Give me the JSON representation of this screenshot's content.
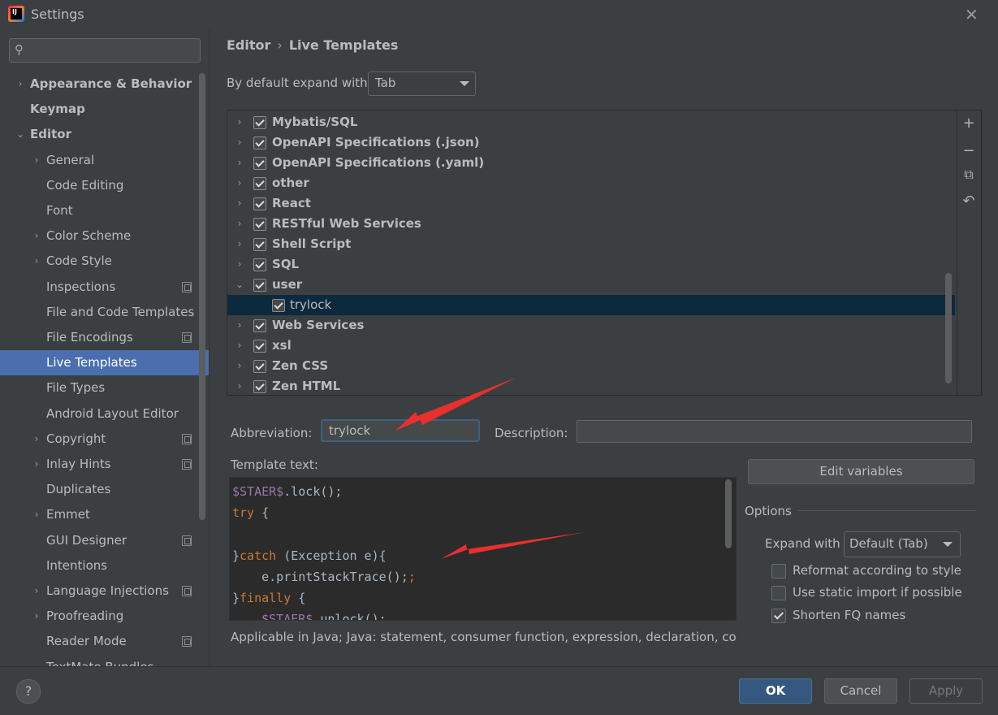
{
  "window": {
    "title": "Settings",
    "close": "✕",
    "logo_text": "IJ"
  },
  "sidebar": {
    "search_placeholder": "",
    "items": [
      {
        "label": "Appearance & Behavior",
        "chevron": "›",
        "level": 0
      },
      {
        "label": "Keymap",
        "chevron": "",
        "level": 0
      },
      {
        "label": "Editor",
        "chevron": "⌄",
        "level": 0
      },
      {
        "label": "General",
        "chevron": "›",
        "level": 1
      },
      {
        "label": "Code Editing",
        "chevron": "",
        "level": 1
      },
      {
        "label": "Font",
        "chevron": "",
        "level": 1
      },
      {
        "label": "Color Scheme",
        "chevron": "›",
        "level": 1
      },
      {
        "label": "Code Style",
        "chevron": "›",
        "level": 1
      },
      {
        "label": "Inspections",
        "chevron": "",
        "level": 1
      },
      {
        "label": "File and Code Templates",
        "chevron": "",
        "level": 1
      },
      {
        "label": "File Encodings",
        "chevron": "",
        "level": 1
      },
      {
        "label": "Live Templates",
        "chevron": "",
        "level": 1
      },
      {
        "label": "File Types",
        "chevron": "",
        "level": 1
      },
      {
        "label": "Android Layout Editor",
        "chevron": "",
        "level": 1
      },
      {
        "label": "Copyright",
        "chevron": "›",
        "level": 1
      },
      {
        "label": "Inlay Hints",
        "chevron": "›",
        "level": 1
      },
      {
        "label": "Duplicates",
        "chevron": "",
        "level": 1
      },
      {
        "label": "Emmet",
        "chevron": "›",
        "level": 1
      },
      {
        "label": "GUI Designer",
        "chevron": "",
        "level": 1
      },
      {
        "label": "Intentions",
        "chevron": "",
        "level": 1
      },
      {
        "label": "Language Injections",
        "chevron": "›",
        "level": 1
      },
      {
        "label": "Proofreading",
        "chevron": "›",
        "level": 1
      },
      {
        "label": "Reader Mode",
        "chevron": "",
        "level": 1
      },
      {
        "label": "TextMate Bundles",
        "chevron": "",
        "level": 1
      }
    ]
  },
  "main": {
    "breadcrumb": {
      "parent": "Editor",
      "sep": "›",
      "current": "Live Templates"
    },
    "expand_label": "By default expand with",
    "expand_value": "Tab",
    "template_groups": [
      {
        "name": "Mybatis/SQL",
        "chevron": "›"
      },
      {
        "name": "OpenAPI Specifications (.json)",
        "chevron": "›"
      },
      {
        "name": "OpenAPI Specifications (.yaml)",
        "chevron": "›"
      },
      {
        "name": "other",
        "chevron": "›"
      },
      {
        "name": "React",
        "chevron": "›"
      },
      {
        "name": "RESTful Web Services",
        "chevron": "›"
      },
      {
        "name": "Shell Script",
        "chevron": "›"
      },
      {
        "name": "SQL",
        "chevron": "›"
      },
      {
        "name": "user",
        "chevron": "⌄"
      },
      {
        "name": "trylock",
        "chevron": "",
        "child": true
      },
      {
        "name": "Web Services",
        "chevron": "›"
      },
      {
        "name": "xsl",
        "chevron": "›"
      },
      {
        "name": "Zen CSS",
        "chevron": "›"
      },
      {
        "name": "Zen HTML",
        "chevron": "›"
      }
    ],
    "toolbar": {
      "add": "+",
      "remove": "−",
      "copy": "⧉",
      "undo": "↶"
    },
    "abbreviation_label": "Abbreviation:",
    "abbreviation_value": "trylock",
    "description_label": "Description:",
    "description_value": "",
    "template_text_label": "Template text:",
    "template_code": {
      "l1_var": "$STAER$",
      "l1_rest": ".lock();",
      "l2_kw": "try",
      "l2_rest": " {",
      "l4_brace": "}",
      "l4_kw": "catch",
      "l4_rest": " (Exception e){",
      "l5": "    e.printStackTrace();",
      "l6_brace": "}",
      "l6_kw": "finally",
      "l6_rest": " {",
      "l7_indent": "    ",
      "l7_var": "$STAER$",
      "l7_rest": ".unlock();"
    },
    "applicable": "Applicable in Java; Java: statement, consumer function, expression, declaration, comm",
    "edit_variables": "Edit variables",
    "options_title": "Options",
    "expand_with_label": "Expand with",
    "expand_with_value": "Default (Tab)",
    "options": [
      {
        "label": "Reformat according to style",
        "checked": false
      },
      {
        "label": "Use static import if possible",
        "checked": false
      },
      {
        "label": "Shorten FQ names",
        "checked": true
      }
    ]
  },
  "footer": {
    "help": "?",
    "ok": "OK",
    "cancel": "Cancel",
    "apply": "Apply"
  },
  "colors": {
    "accent": "#4b6eaf",
    "arrow": "#e8302e",
    "selected_row": "#0d293e"
  }
}
